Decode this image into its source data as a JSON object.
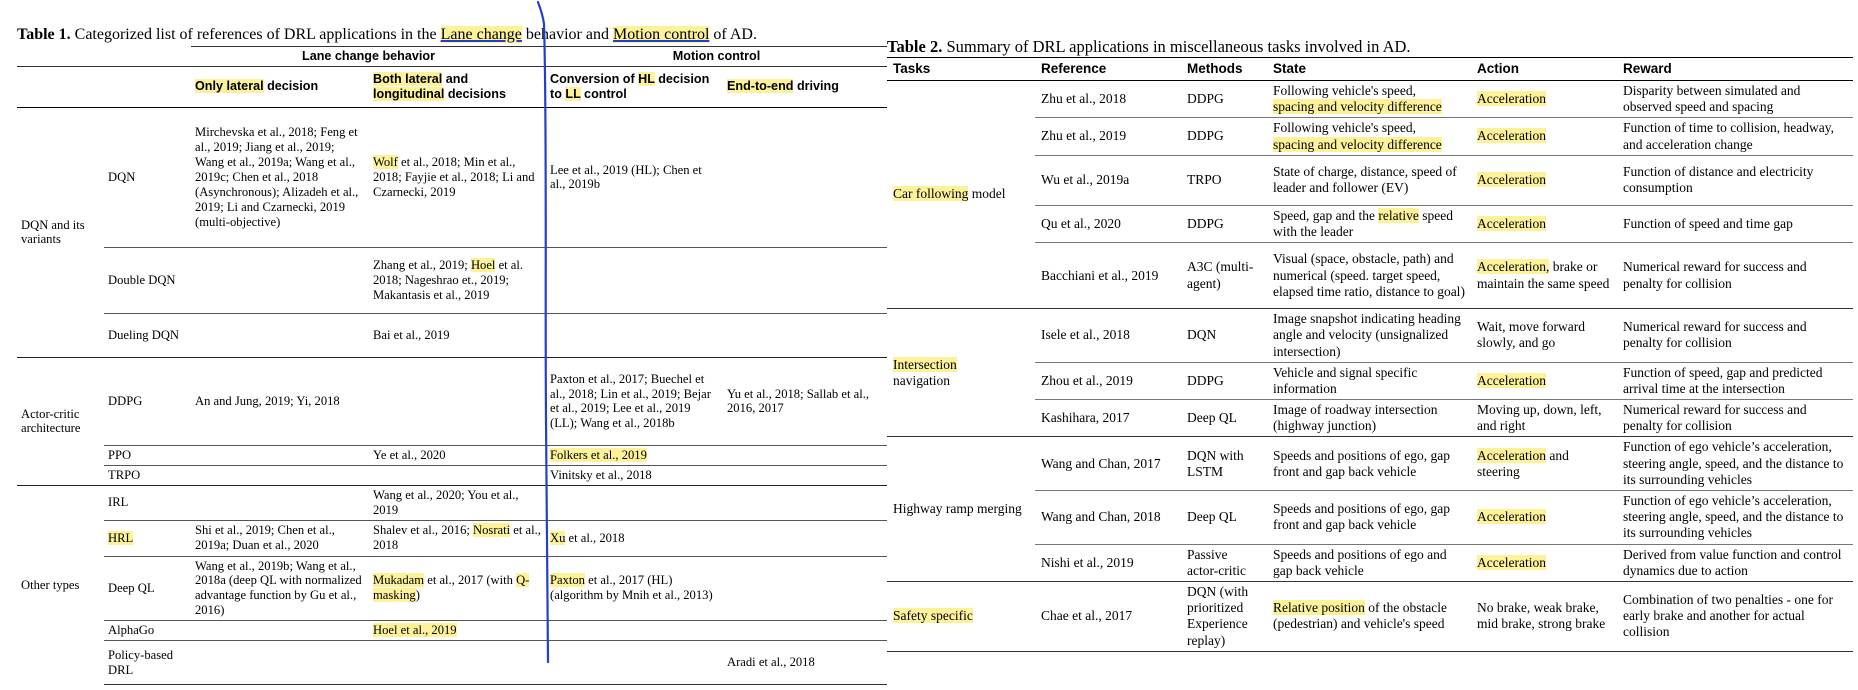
{
  "table1": {
    "title_prefix": "Table 1.",
    "title_a": " Categorized list of references of DRL applications in the ",
    "title_hl1": "Lane change",
    "title_b": " behavior and ",
    "title_hl2": "Motion control",
    "title_c": " of AD.",
    "group_lane": "Lane change behavior",
    "group_motion": "Motion control",
    "h_only_lateral_hl": "Only lateral",
    "h_only_lateral_rest": " decision",
    "h_both_hl": "Both lateral",
    "h_both_mid": " and",
    "h_both_hl2": "longitudinal",
    "h_both_rest": " decisions",
    "h_conv_a": "Conversion of ",
    "h_conv_hl": "HL",
    "h_conv_b": " decision",
    "h_conv_c": "to ",
    "h_conv_hl2": "LL",
    "h_conv_d": " control",
    "h_e2e_hl": "End-to-end",
    "h_e2e_rest": " driving",
    "cat_dqn": "DQN and its variants",
    "cat_ac": "Actor-critic architecture",
    "cat_other": "Other types",
    "dqn": {
      "name": "DQN",
      "only_lateral": "Mirchevska et al., 2018; Feng et al., 2019; Jiang et al., 2019; Wang et al., 2019a; Wang et al., 2019c; Chen et al., 2018 (Asynchronous); Alizadeh et al., 2019; Li and Czarnecki, 2019 (multi-objective)",
      "both_hl": "Wolf",
      "both_rest": " et al., 2018; Min et al., 2018; Fayjie et al., 2018;  Li and Czarnecki, 2019",
      "conv": "Lee et al., 2019 (HL); Chen et al., 2019b"
    },
    "double_dqn": {
      "name": "Double DQN",
      "both_a": "Zhang et al., 2019; ",
      "both_hl": "Hoel",
      "both_b": " et al. 2018; Nageshrao et., 2019; Makantasis et al., 2019"
    },
    "dueling_dqn": {
      "name": "Dueling DQN",
      "both": "Bai et al., 2019"
    },
    "ddpg": {
      "name": "DDPG",
      "only_lateral": "An and Jung, 2019; Yi, 2018",
      "conv": "Paxton et al., 2017; Buechel et al., 2018; Lin et al., 2019; Bejar et al., 2019; Lee et al., 2019 (LL);  Wang et al., 2018b",
      "e2e": "Yu et al., 2018; Sallab et al., 2016, 2017"
    },
    "ppo": {
      "name": "PPO",
      "both": "Ye et al., 2020",
      "conv_hl": "Folkers et al., 2019"
    },
    "trpo": {
      "name": "TRPO",
      "conv": "Vinitsky et al., 2018"
    },
    "irl": {
      "name": "IRL",
      "both": "Wang et al., 2020; You et al., 2019"
    },
    "hrl": {
      "name_hl": "HRL",
      "only_lateral": "Shi et al., 2019; Chen et al., 2019a; Duan et al., 2020",
      "both_a": "Shalev et al., 2016;  ",
      "both_hl": "Nosrati",
      "both_b": " et al., 2018",
      "conv_hl": "Xu",
      "conv_rest": " et al., 2018"
    },
    "deep_ql": {
      "name": "Deep QL",
      "only_lateral": "Wang et al., 2019b; Wang et al., 2018a (deep QL with normalized advantage function by Gu et al., 2016)",
      "both_hl": "Mukadam",
      "both_a": " et al., 2017 (with ",
      "both_hl2": "Q-masking",
      "both_b": ")",
      "conv_hl": "Paxton",
      "conv_rest": " et al., 2017 (HL) (algorithm by Mnih et al., 2013)"
    },
    "alphago": {
      "name": "AlphaGo",
      "both_hl": "Hoel et al., 2019"
    },
    "policy": {
      "name": "Policy-based DRL",
      "e2e": "Aradi et al., 2018"
    }
  },
  "table2": {
    "title_prefix": "Table 2.",
    "title_rest": " Summary of DRL applications in miscellaneous tasks involved in AD.",
    "headers": [
      "Tasks",
      "Reference",
      "Methods",
      "State",
      "Action",
      "Reward"
    ],
    "task_car_hl": "Car following",
    "task_car_rest": " model",
    "task_inter_hl": "Intersection",
    "task_inter_rest": "navigation",
    "task_highway": "Highway ramp merging",
    "task_safety_hl": "Safety specific",
    "rows": {
      "r1": {
        "ref": "Zhu et al., 2018",
        "method": "DDPG",
        "state_a": "Following vehicle's speed,",
        "state_hl": "spacing and velocity difference",
        "action_hl": "Acceleration",
        "reward": "Disparity between simulated and observed speed and spacing"
      },
      "r2": {
        "ref": "Zhu et al., 2019",
        "method": "DDPG",
        "state_a": "Following vehicle's speed,",
        "state_hl": "spacing and velocity difference",
        "action_hl": "Acceleration",
        "reward": "Function of time to collision, headway, and acceleration change"
      },
      "r3": {
        "ref": "Wu et al., 2019a",
        "method": "TRPO",
        "state": "State of charge, distance, speed of leader and follower (EV)",
        "action_hl": "Acceleration",
        "reward": "Function of distance and electricity consumption"
      },
      "r4": {
        "ref": "Qu et al., 2020",
        "method": "DDPG",
        "state_a": "Speed, gap and the ",
        "state_hl": "relative",
        "state_b": " speed with the leader",
        "action_hl": "Acceleration",
        "reward": "Function of speed and time gap"
      },
      "r5": {
        "ref": "Bacchiani et al., 2019",
        "method": "A3C (multi-agent)",
        "state": "Visual (space, obstacle, path) and numerical (speed. target speed, elapsed time ratio, distance to goal)",
        "action_hl": "Acceleration,",
        "action_rest": " brake or maintain the same speed",
        "reward": "Numerical reward for success and penalty for collision"
      },
      "r6": {
        "ref": "Isele et al., 2018",
        "method": "DQN",
        "state": "Image snapshot indicating heading angle and velocity (unsignalized intersection)",
        "action": "Wait, move forward slowly, and go",
        "reward": "Numerical reward for success and penalty for collision"
      },
      "r7": {
        "ref": "Zhou et al., 2019",
        "method": "DDPG",
        "state": "Vehicle and signal specific information",
        "action_hl": "Acceleration",
        "reward": "Function of speed, gap and predicted arrival time at the intersection"
      },
      "r8": {
        "ref": "Kashihara, 2017",
        "method": "Deep QL",
        "state": "Image of roadway intersection (highway junction)",
        "action": "Moving up, down, left, and right",
        "reward": "Numerical reward for success and penalty for collision"
      },
      "r9": {
        "ref": "Wang and Chan, 2017",
        "method": "DQN with LSTM",
        "state": "Speeds and positions of ego, gap front and gap back vehicle",
        "action_hl": "Acceleration",
        "action_rest": " and steering",
        "reward": "Function of ego vehicle’s acceleration, steering angle, speed, and the distance to its surrounding vehicles"
      },
      "r10": {
        "ref": "Wang and Chan, 2018",
        "method": "Deep QL",
        "state": "Speeds and positions of ego, gap front and gap back vehicle",
        "action_hl": "Acceleration",
        "reward": "Function of ego vehicle’s acceleration, steering angle, speed, and the distance to its surrounding vehicles"
      },
      "r11": {
        "ref": "Nishi et al., 2019",
        "method": "Passive actor-critic",
        "state": "Speeds and positions of ego and gap back vehicle",
        "action_hl": "Acceleration",
        "reward": "Derived from value function and control dynamics due to action"
      },
      "r12": {
        "ref": "Chae et al., 2017",
        "method": "DQN (with prioritized Experience replay)",
        "state_hl": "Relative position",
        "state_rest": " of the obstacle (pedestrian) and vehicle's speed",
        "action": "No brake, weak brake, mid brake, strong brake",
        "reward": "Combination of two penalties - one for early brake and another for actual collision"
      }
    }
  },
  "colors": {
    "highlight": "#fdf29a",
    "pen": "#2340c8"
  }
}
